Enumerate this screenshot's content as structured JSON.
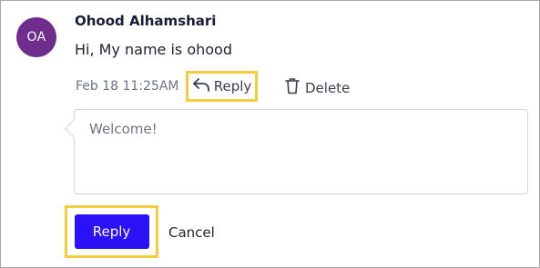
{
  "comment": {
    "avatar_initials": "OA",
    "author": "Ohood Alhamshari",
    "message": "Hi, My name is ohood",
    "timestamp": "Feb 18 11:25AM",
    "actions": {
      "reply_label": "Reply",
      "reply_icon": "reply-arrow-icon",
      "delete_label": "Delete",
      "delete_icon": "trash-icon"
    }
  },
  "reply_form": {
    "value": "Welcome!",
    "submit_label": "Reply",
    "cancel_label": "Cancel"
  },
  "colors": {
    "avatar": "#6f2d8e",
    "primary_button": "#2b11f5",
    "highlight": "#f5cd3a"
  }
}
